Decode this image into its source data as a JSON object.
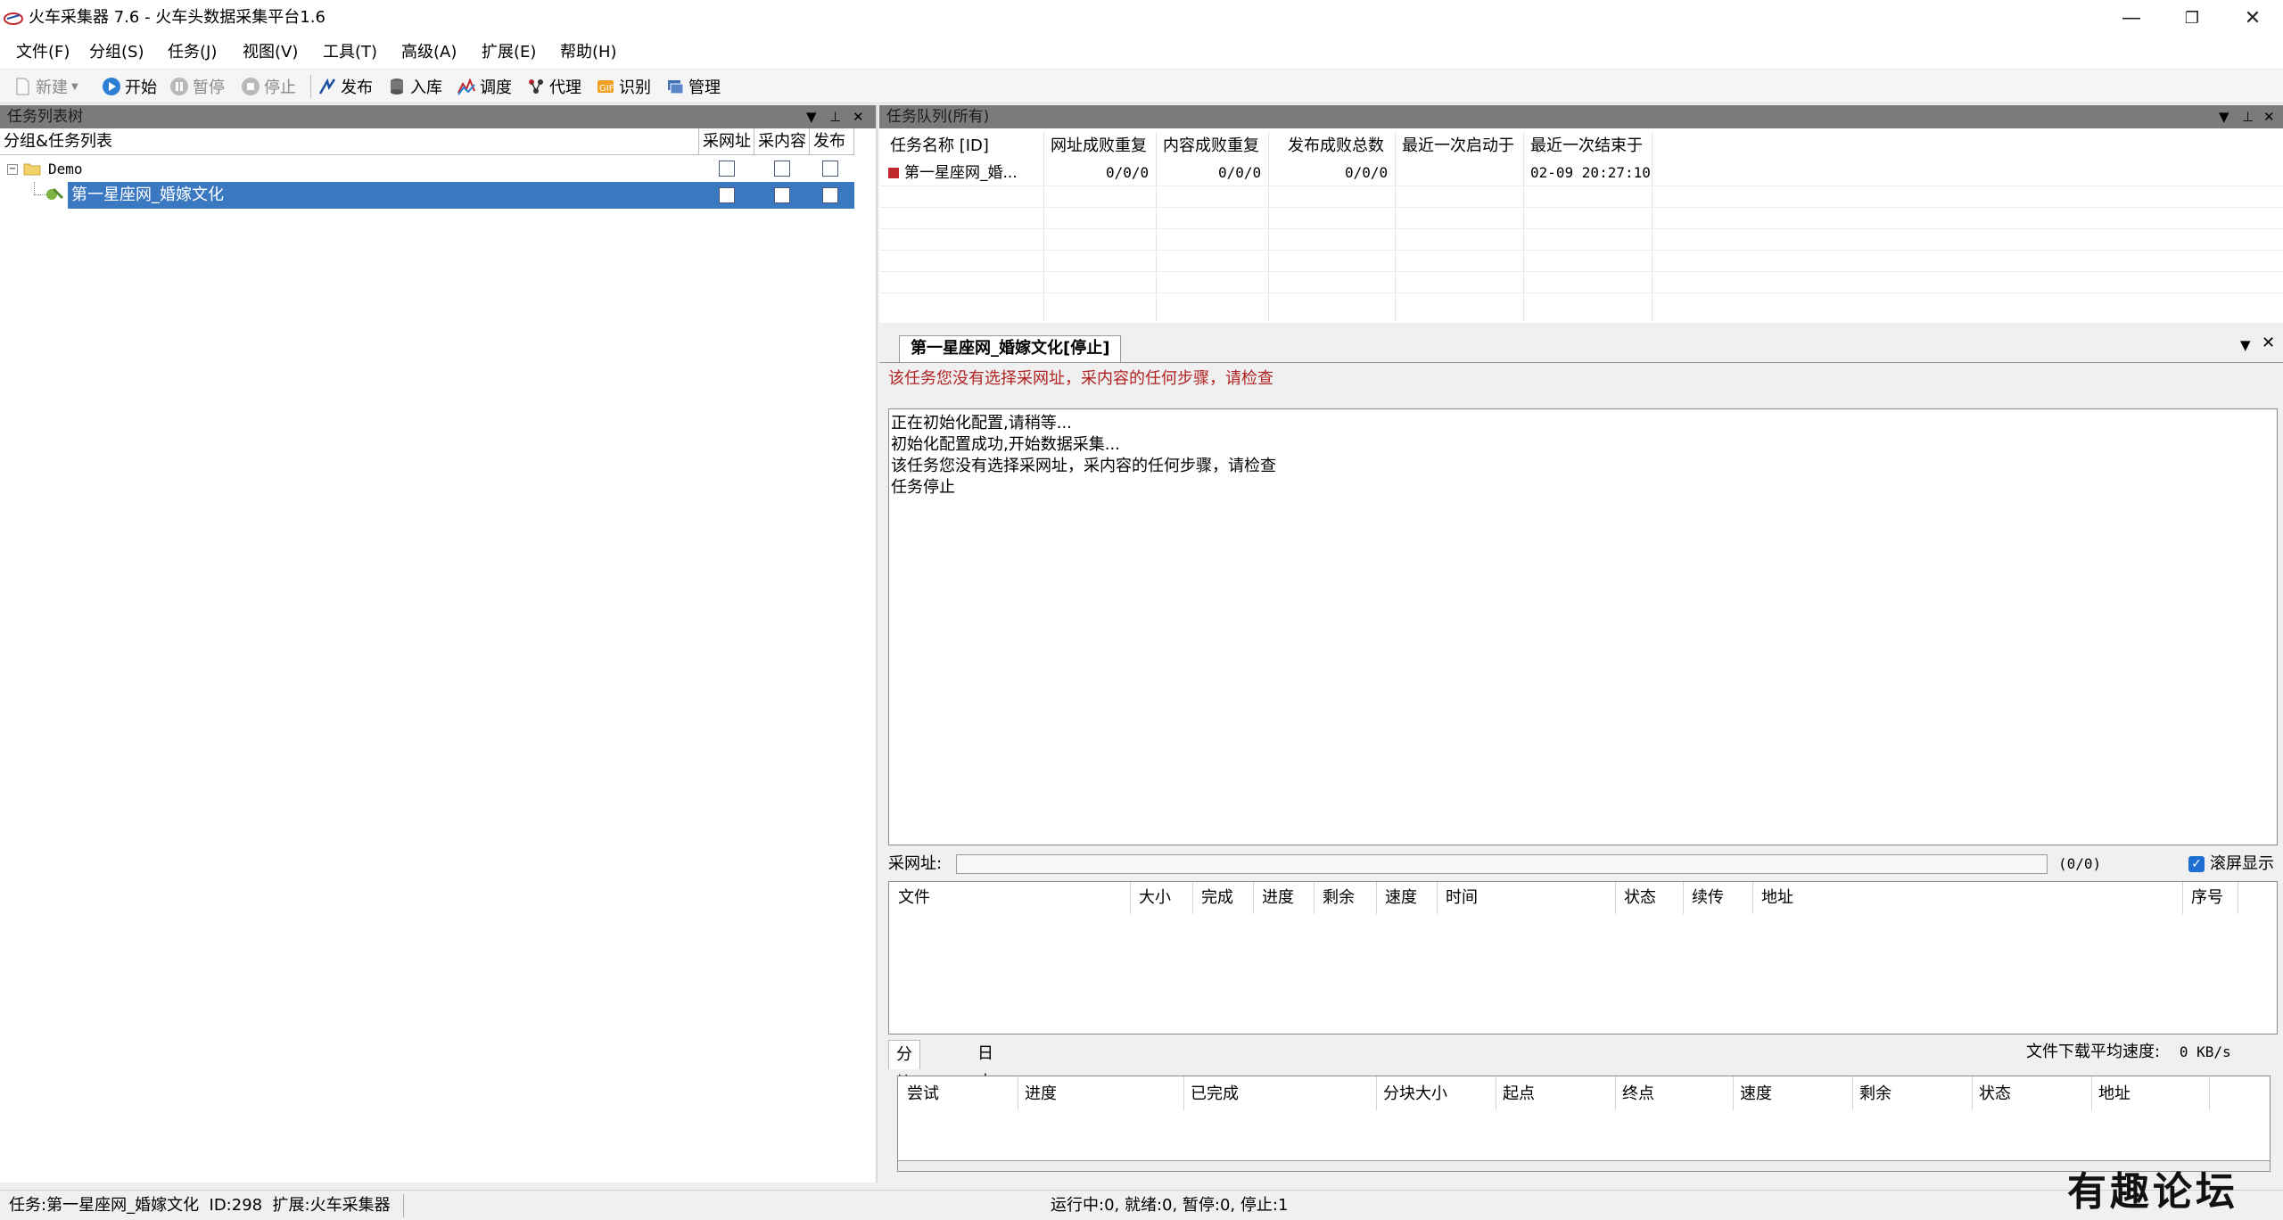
{
  "window": {
    "title": "火车采集器 7.6 - 火车头数据采集平台1.6",
    "minimize_glyph": "—",
    "restore_glyph": "❐",
    "close_glyph": "✕"
  },
  "menu": [
    "文件(F)",
    "分组(S)",
    "任务(J)",
    "视图(V)",
    "工具(T)",
    "高级(A)",
    "扩展(E)",
    "帮助(H)"
  ],
  "toolbar": [
    {
      "label": "新建",
      "icon": "new-file-icon",
      "enabled": false
    },
    {
      "label": "开始",
      "icon": "play-icon",
      "enabled": true
    },
    {
      "label": "暂停",
      "icon": "pause-icon",
      "enabled": false
    },
    {
      "label": "停止",
      "icon": "stop-icon",
      "enabled": false
    },
    {
      "label": "发布",
      "icon": "publish-icon",
      "enabled": true
    },
    {
      "label": "入库",
      "icon": "database-icon",
      "enabled": true
    },
    {
      "label": "调度",
      "icon": "schedule-icon",
      "enabled": true
    },
    {
      "label": "代理",
      "icon": "proxy-icon",
      "enabled": true
    },
    {
      "label": "识别",
      "icon": "recognize-icon",
      "enabled": true
    },
    {
      "label": "管理",
      "icon": "manage-icon",
      "enabled": true
    }
  ],
  "task_tree": {
    "panel_title": "任务列表树",
    "headers": {
      "name": "分组&任务列表",
      "col1": "采网址",
      "col2": "采内容",
      "col3": "发布"
    },
    "group_name": "Demo",
    "task_name": "第一星座网_婚嫁文化"
  },
  "queue": {
    "panel_title": "任务队列(所有)",
    "headers": [
      "任务名称 [ID]",
      "网址成败重复",
      "内容成败重复",
      "发布成败总数",
      "最近一次启动于",
      "最近一次结束于"
    ],
    "row": [
      "第一星座网_婚...",
      "0/0/0",
      "0/0/0",
      "0/0/0",
      "",
      "02-09 20:27:10"
    ]
  },
  "detail": {
    "tab_title": "第一星座网_婚嫁文化[停止]",
    "warning": "该任务您没有选择采网址，采内容的任何步骤，请检查",
    "log": [
      "正在初始化配置,请稍等...",
      "初始化配置成功,开始数据采集...",
      "该任务您没有选择采网址，采内容的任何步骤，请检查",
      "任务停止"
    ],
    "url_label": "采网址:",
    "url_count": "(0/0)",
    "scroll_label": "滚屏显示",
    "scroll_checked": true,
    "file_headers": [
      "文件",
      "大小",
      "完成",
      "进度",
      "剩余",
      "速度",
      "时间",
      "状态",
      "续传",
      "地址",
      "序号"
    ],
    "bottom_tabs": [
      "分块下载",
      "日志"
    ],
    "speed_label": "文件下载平均速度:",
    "speed_value": "0 KB/s",
    "chunk_headers": [
      "尝试",
      "进度",
      "已完成",
      "分块大小",
      "起点",
      "终点",
      "速度",
      "剩余",
      "状态",
      "地址"
    ]
  },
  "status": {
    "task_info": "任务:第一星座网_婚嫁文化  ID:298  扩展:火车采集器",
    "run_info": "运行中:0, 就绪:0, 暂停:0, 停止:1"
  },
  "watermark": "有趣论坛",
  "colors": {
    "panel_header": "#7b7b7b",
    "selection": "#3a78c2",
    "warning": "#b22222"
  }
}
